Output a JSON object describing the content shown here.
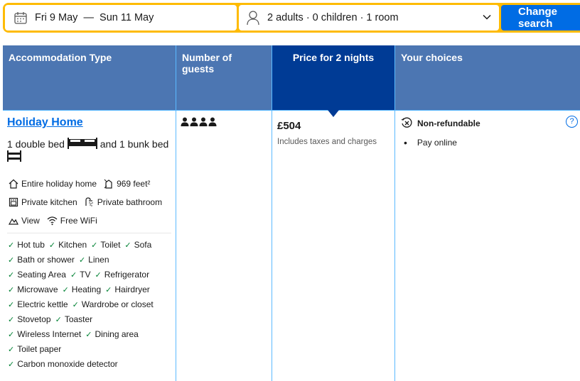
{
  "search": {
    "dates": "Fri 9 May  —  Sun 11 May",
    "occupancy": "2 adults · 0 children · 1 room",
    "button": "Change search"
  },
  "table": {
    "headers": [
      "Accommodation Type",
      "Number of guests",
      "Price for 2 nights",
      "Your choices"
    ]
  },
  "room": {
    "name": "Holiday Home",
    "bed_part1": "1 double bed",
    "bed_part2": "and 1 bunk bed",
    "facilities": {
      "entire": "Entire holiday home",
      "size": "969 feet²",
      "kitchen": "Private kitchen",
      "bathroom": "Private bathroom",
      "view": "View",
      "wifi": "Free WiFi"
    },
    "amenities": [
      "Hot tub",
      "Kitchen",
      "Toilet",
      "Sofa",
      "Bath or shower",
      "Linen",
      "Seating Area",
      "TV",
      "Refrigerator",
      "Microwave",
      "Heating",
      "Hairdryer",
      "Electric kettle",
      "Wardrobe or closet",
      "Stovetop",
      "Toaster",
      "Wireless Internet",
      "Dining area",
      "Toilet paper",
      "Carbon monoxide detector"
    ]
  },
  "guests": {
    "count": 4,
    "icon": "person-icon"
  },
  "price": {
    "amount": "£504",
    "note": "Includes taxes and charges"
  },
  "choices": {
    "refund": "Non-refundable",
    "payment": "Pay online",
    "help": "?"
  },
  "colors": {
    "accent_yellow": "#febb02",
    "brand_blue": "#006ce4",
    "header_blue": "#4c76b2",
    "selected_header": "#003b95",
    "check_green": "#008234"
  }
}
